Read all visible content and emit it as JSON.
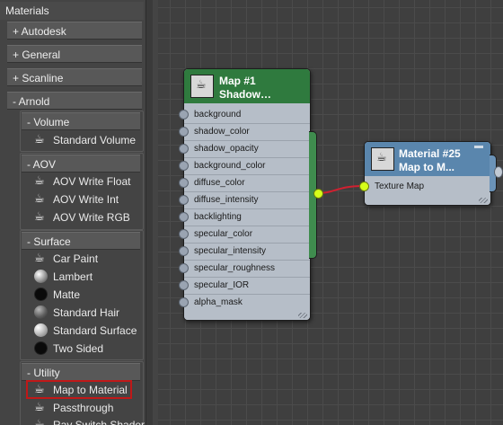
{
  "browser": {
    "title": "Materials",
    "categories": {
      "autodesk": "+ Autodesk",
      "general": "+ General",
      "scanline": "+ Scanline",
      "arnold": "- Arnold"
    },
    "groups": {
      "volume": {
        "label": "- Volume",
        "items": [
          "Standard Volume"
        ]
      },
      "aov": {
        "label": "- AOV",
        "items": [
          "AOV Write Float",
          "AOV Write Int",
          "AOV Write RGB"
        ]
      },
      "surface": {
        "label": "- Surface",
        "items": [
          "Car Paint",
          "Lambert",
          "Matte",
          "Standard Hair",
          "Standard Surface",
          "Two Sided"
        ]
      },
      "utility": {
        "label": "- Utility",
        "items": [
          "Map to Material",
          "Passthrough",
          "Ray Switch Shader"
        ]
      }
    },
    "selected_item": "Map to Material"
  },
  "nodes": {
    "map1": {
      "title_line1": "Map #1",
      "title_line2": "Shadow…",
      "slots": [
        "background",
        "shadow_color",
        "shadow_opacity",
        "background_color",
        "diffuse_color",
        "diffuse_intensity",
        "backlighting",
        "specular_color",
        "specular_intensity",
        "specular_roughness",
        "specular_IOR",
        "alpha_mask"
      ],
      "header_color": "#2f7a3e"
    },
    "material25": {
      "title_line1": "Material #25",
      "title_line2": "Map to M...",
      "slots": [
        "Texture Map"
      ],
      "header_color": "#5a86ad"
    }
  },
  "colors": {
    "connection_wire": "#d02030",
    "output_socket": "#d6ff1a",
    "selection_outline": "#c01818"
  }
}
